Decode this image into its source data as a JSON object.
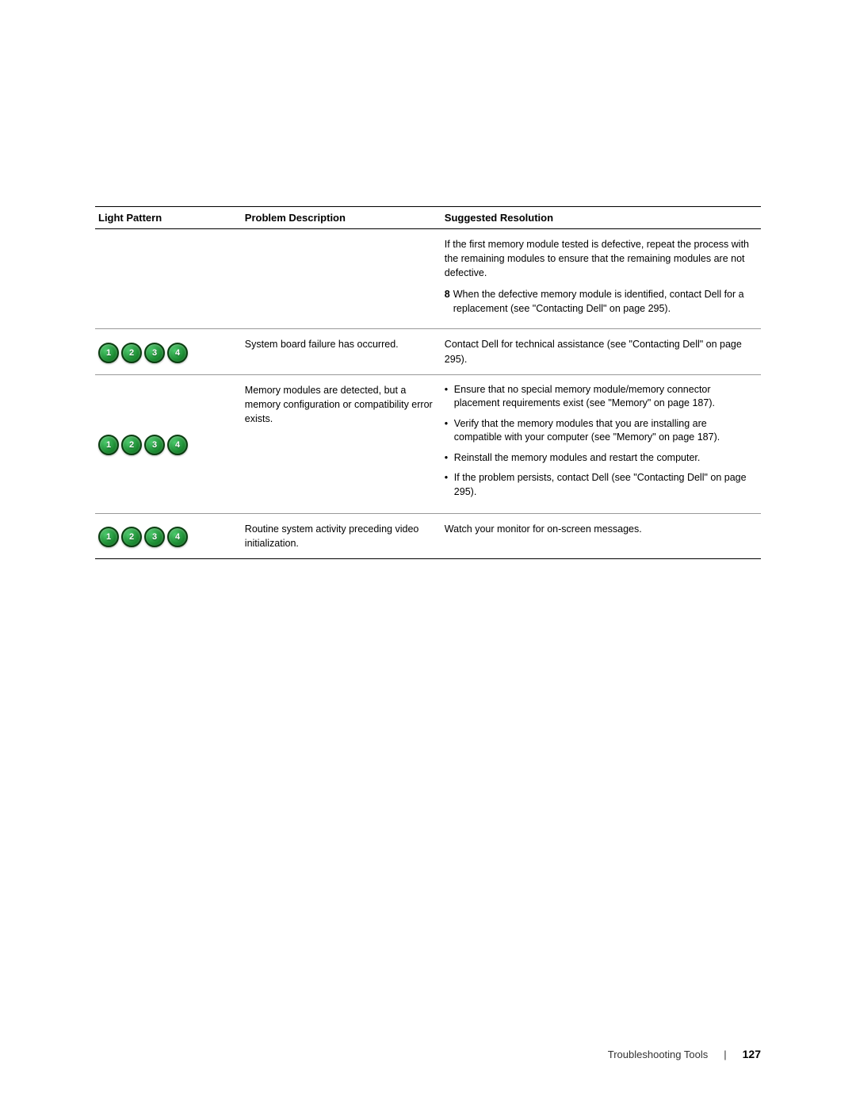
{
  "page": {
    "footer": {
      "label": "Troubleshooting Tools",
      "separator": "|",
      "page_number": "127"
    }
  },
  "table": {
    "headers": {
      "light_pattern": "Light Pattern",
      "problem_description": "Problem Description",
      "suggested_resolution": "Suggested Resolution"
    },
    "rows": [
      {
        "id": "continuation",
        "light_icons": [],
        "problem": "",
        "solution_type": "continuation",
        "solution_lines": [
          "If the first memory module tested is defective, repeat the process with the remaining modules to ensure that the remaining modules are not defective.",
          "8 When the defective memory module is identified, contact Dell for a replacement (see \"Contacting Dell\" on page 295)."
        ]
      },
      {
        "id": "row1",
        "light_icons": [
          {
            "label": "1",
            "filled": true
          },
          {
            "label": "2",
            "filled": true
          },
          {
            "label": "3",
            "filled": true
          },
          {
            "label": "4",
            "filled": true
          }
        ],
        "problem": "System board failure has occurred.",
        "solution_type": "text",
        "solution_text": "Contact Dell for technical assistance (see \"Contacting Dell\" on page 295)."
      },
      {
        "id": "row2",
        "light_icons": [
          {
            "label": "1",
            "filled": true
          },
          {
            "label": "2",
            "filled": true
          },
          {
            "label": "3",
            "filled": true
          },
          {
            "label": "4",
            "filled": true
          }
        ],
        "problem": "Memory modules are detected, but a memory configuration or compatibility error exists.",
        "solution_type": "bullets",
        "bullets": [
          "Ensure that no special memory module/memory connector placement requirements exist (see \"Memory\" on page 187).",
          "Verify that the memory modules that you are installing are compatible with your computer (see \"Memory\" on page 187).",
          "Reinstall the memory modules and restart the computer.",
          "If the problem persists, contact Dell (see \"Contacting Dell\" on page 295)."
        ]
      },
      {
        "id": "row3",
        "light_icons": [
          {
            "label": "1",
            "filled": true
          },
          {
            "label": "2",
            "filled": true
          },
          {
            "label": "3",
            "filled": true
          },
          {
            "label": "4",
            "filled": true
          }
        ],
        "problem": "Routine system activity preceding video initialization.",
        "solution_type": "text",
        "solution_text": "Watch your monitor for on-screen messages."
      }
    ]
  }
}
